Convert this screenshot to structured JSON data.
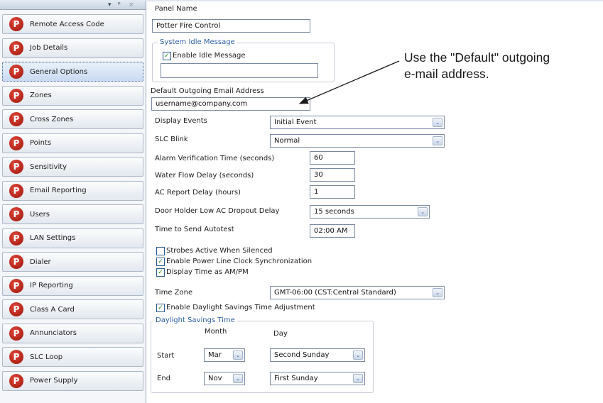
{
  "sidebar": {
    "header_icons": {
      "dropdown": "▾",
      "pin": "ᵖ",
      "close": "×"
    },
    "items": [
      {
        "label": "Remote Access Code",
        "icon": "p-icon",
        "active": false
      },
      {
        "label": "Job Details",
        "icon": "p-icon",
        "active": false
      },
      {
        "label": "General Options",
        "icon": "p-icon",
        "active": true
      },
      {
        "label": "Zones",
        "icon": "p-icon",
        "active": false
      },
      {
        "label": "Cross Zones",
        "icon": "p-icon",
        "active": false
      },
      {
        "label": "Points",
        "icon": "p-icon",
        "active": false
      },
      {
        "label": "Sensitivity",
        "icon": "p-icon",
        "active": false
      },
      {
        "label": "Email Reporting",
        "icon": "p-icon",
        "active": false
      },
      {
        "label": "Users",
        "icon": "p-icon",
        "active": false
      },
      {
        "label": "LAN Settings",
        "icon": "p-icon",
        "active": false
      },
      {
        "label": "Dialer",
        "icon": "p-icon",
        "active": false
      },
      {
        "label": "IP Reporting",
        "icon": "p-icon",
        "active": false
      },
      {
        "label": "Class A Card",
        "icon": "p-icon",
        "active": false
      },
      {
        "label": "Annunciators",
        "icon": "p-icon",
        "active": false
      },
      {
        "label": "SLC Loop",
        "icon": "p-icon",
        "active": false
      },
      {
        "label": "Power Supply",
        "icon": "p-icon",
        "active": false
      }
    ]
  },
  "form": {
    "panel_name": {
      "label": "Panel Name",
      "value": "Potter Fire Control"
    },
    "idle_group": {
      "title": "System Idle Message",
      "enable_label": "Enable Idle Message",
      "enable_checked": true,
      "message_value": ""
    },
    "default_email": {
      "label": "Default Outgoing Email Address",
      "value": "username@company.com"
    },
    "display_events": {
      "label": "Display Events",
      "value": "Initial Event"
    },
    "slc_blink": {
      "label": "SLC Blink",
      "value": "Normal"
    },
    "alarm_verification": {
      "label": "Alarm Verification Time (seconds)",
      "value": "60"
    },
    "water_flow": {
      "label": "Water Flow Delay (seconds)",
      "value": "30"
    },
    "ac_report": {
      "label": "AC Report Delay (hours)",
      "value": "1"
    },
    "door_holder": {
      "label": "Door Holder Low AC Dropout Delay",
      "value": "15 seconds"
    },
    "autotest": {
      "label": "Time to Send Autotest",
      "value": "02:00 AM"
    },
    "strobes": {
      "label": "Strobes Active When Silenced",
      "checked": false
    },
    "power_line_sync": {
      "label": "Enable Power Line Clock Synchronization",
      "checked": true
    },
    "ampm": {
      "label": "Display Time as AM/PM",
      "checked": true
    },
    "time_zone": {
      "label": "Time Zone",
      "value": "GMT-06:00 (CST:Central Standard)"
    },
    "dst_enable": {
      "label": "Enable Daylight Savings Time Adjustment",
      "checked": true
    },
    "dst_group": {
      "title": "Daylight Savings Time",
      "month_header": "Month",
      "day_header": "Day",
      "start": {
        "label": "Start",
        "month": "Mar",
        "day": "Second Sunday"
      },
      "end": {
        "label": "End",
        "month": "Nov",
        "day": "First Sunday"
      }
    },
    "dropdown_glyph": "⌄",
    "check_glyph": "✓"
  },
  "callout": {
    "line1": "Use the \"Default\" outgoing",
    "line2": "e-mail address."
  }
}
